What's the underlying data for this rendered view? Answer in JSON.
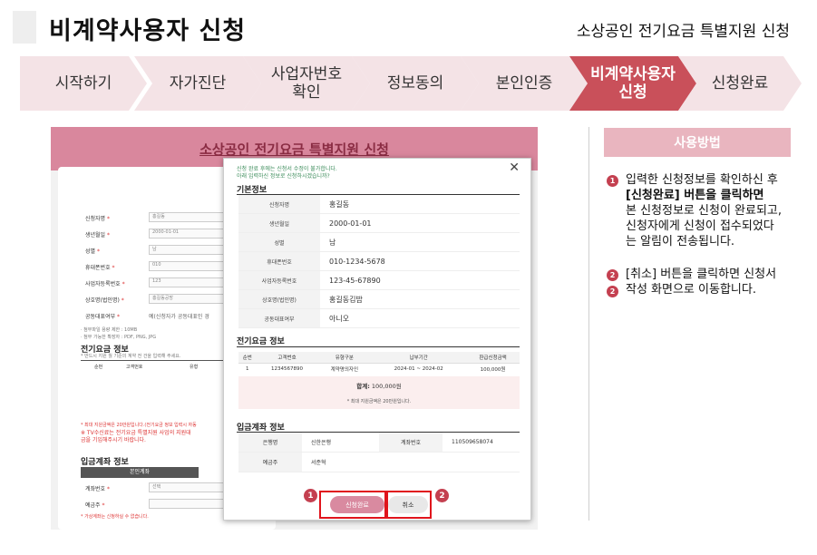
{
  "header": {
    "title": "비계약사용자 신청",
    "subtitle": "소상공인 전기요금 특별지원 신청"
  },
  "steps": [
    {
      "label": "시작하기",
      "active": false
    },
    {
      "label": "자가진단",
      "active": false
    },
    {
      "label": "사업자번호\n확인",
      "active": false
    },
    {
      "label": "정보동의",
      "active": false
    },
    {
      "label": "본인인증",
      "active": false
    },
    {
      "label": "비계약사용자\n신청",
      "active": true
    },
    {
      "label": "신청완료",
      "active": false
    }
  ],
  "background_form": {
    "title": "소상공인 전기요금 특별지원 신청",
    "fields": [
      {
        "label": "신청자명",
        "value": "홍길동"
      },
      {
        "label": "생년월일",
        "value": "2000-01-01"
      },
      {
        "label": "성별",
        "value": "남"
      },
      {
        "label": "휴대폰번호",
        "value": "010"
      },
      {
        "label": "사업자등록번호",
        "value": "123"
      },
      {
        "label": "상호명(법인명)",
        "value": "홍길동공방"
      },
      {
        "label": "공동대표여부",
        "value": "예(신청자가 공동대표인 경"
      }
    ],
    "file_note_1": "· 첨부파일 용량 제한 : 10MB",
    "file_note_2": "· 첨부 가능한 확장자 : PDF, PNG, JPG",
    "elec_section": "전기요금 정보",
    "elec_note": "* 반드시 지원 월 기준의 계약 전 건을 입력해 주세요.",
    "elec_cols": [
      "순번",
      "고객번호",
      "유형"
    ],
    "warn_1": "* 최대 지원금액은 20만원입니다.(전기요금 정보 입력시 자동",
    "warn_2": "※ TV수신료는 전기요금 특별지원 사업의 지원대",
    "warn_3": "금을 기입해주시기 바랍니다.",
    "account_section": "입금계좌 정보",
    "account_tab": "본인계좌",
    "account_fields": [
      {
        "label": "계좌번호",
        "value": "선택"
      },
      {
        "label": "예금주",
        "value": ""
      }
    ],
    "account_note": "* 가상계좌는 신청하실 수 없습니다."
  },
  "modal": {
    "notice_1": "신청 완료 후에는 신청서 수정이 불가합니다.",
    "notice_2": "아래 입력하신 정보로 신청하시겠습니까?",
    "basic_title": "기본정보",
    "basic_rows": [
      {
        "label": "신청자명",
        "value": "홍길동"
      },
      {
        "label": "생년월일",
        "value": "2000-01-01"
      },
      {
        "label": "성별",
        "value": "남"
      },
      {
        "label": "휴대폰번호",
        "value": "010-1234-5678"
      },
      {
        "label": "사업자등록번호",
        "value": "123-45-67890"
      },
      {
        "label": "상호명(법인명)",
        "value": "홍길동김밥"
      },
      {
        "label": "공동대표여부",
        "value": "아니오"
      }
    ],
    "elec_title": "전기요금 정보",
    "elec_cols": [
      "순번",
      "고객번호",
      "유형구분",
      "납부기간",
      "환급신청금액"
    ],
    "elec_rows": [
      [
        "1",
        "1234567890",
        "계약명의자인",
        "2024-01 ~ 2024-02",
        "100,000원"
      ]
    ],
    "sum_label": "합계:",
    "sum_value": "100,000원",
    "sum_note": "* 최대 지원금액은 20만원입니다.",
    "account_title": "입금계좌 정보",
    "bank_label": "은행명",
    "bank_value": "신한은행",
    "account_label": "계좌번호",
    "account_value": "110509658074",
    "holder_label": "예금주",
    "holder_value": "서준혁",
    "submit_label": "신청완료",
    "cancel_label": "취소",
    "badge_1": "1",
    "badge_2": "2"
  },
  "usage": {
    "title": "사용방법",
    "step1_badge": "1",
    "step1_lines": [
      "입력한 신청정보를 확인하신 후",
      "[신청완료] 버튼을 클릭하면",
      "본 신청정보로 신청이 완료되고,",
      "신청자에게 신청이 접수되었다",
      "는 알림이 전송됩니다."
    ],
    "step2_badge": "2",
    "step2_lines": [
      "[취소] 버튼을 클릭하면 신청서",
      "작성 화면으로 이동합니다."
    ]
  },
  "colors": {
    "accent": "#c9505a",
    "step_bg": "#f4e3e6",
    "usage_head": "#e9b5bf",
    "highlight": "#e0141c"
  }
}
